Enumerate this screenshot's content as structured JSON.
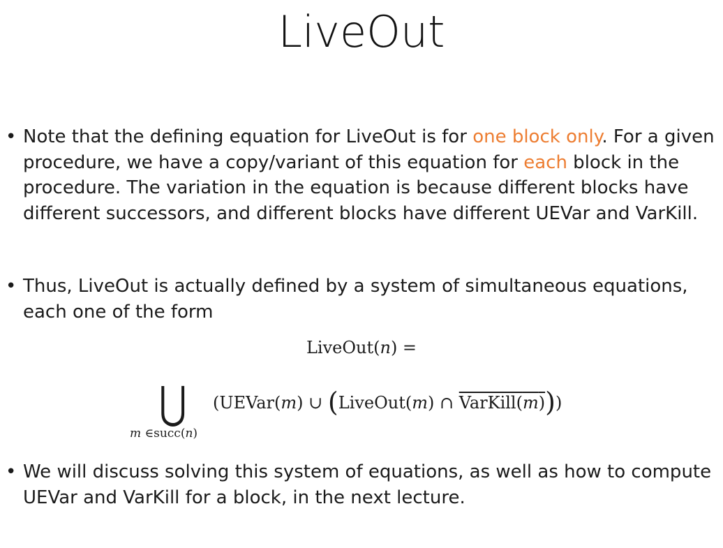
{
  "slide": {
    "title": "LiveOut",
    "bullet_char": "•",
    "bullet1": {
      "part1": "Note that the defining equation for LiveOut is for ",
      "hl1": "one block only",
      "part2": ".  For a given procedure, we have a copy/variant of this equation for ",
      "hl2": "each",
      "part3": " block in the procedure.  The variation in the equation is because different blocks have different successors, and different blocks have different UEVar and VarKill."
    },
    "bullet2": {
      "text": "Thus, LiveOut is actually defined by a system of simultaneous equations, each one of the form"
    },
    "equation": {
      "lhs_func": "LiveOut(",
      "lhs_var": "n",
      "lhs_close": ") =",
      "union_symbol": "⋃",
      "sub_var": "m",
      "sub_in": " ∈succ(",
      "sub_n": "n",
      "sub_close": ")",
      "t_open": "(UEVar(",
      "t_m1": "m",
      "t_close1": ") ∪ ",
      "t_paren_open": "(",
      "t_liveout": "LiveOut(",
      "t_m2": "m",
      "t_cap": ") ∩ ",
      "t_varkill": "VarKill(",
      "t_m3": "m",
      "t_varkill_close": ")",
      "t_paren_close": ")",
      "t_end": ")"
    },
    "bullet3": {
      "text": "We will discuss solving this system of equations, as well as how to compute UEVar and VarKill for a block, in the next lecture."
    },
    "colors": {
      "highlight": "#ED7D31",
      "text": "#1a1a1a"
    }
  }
}
